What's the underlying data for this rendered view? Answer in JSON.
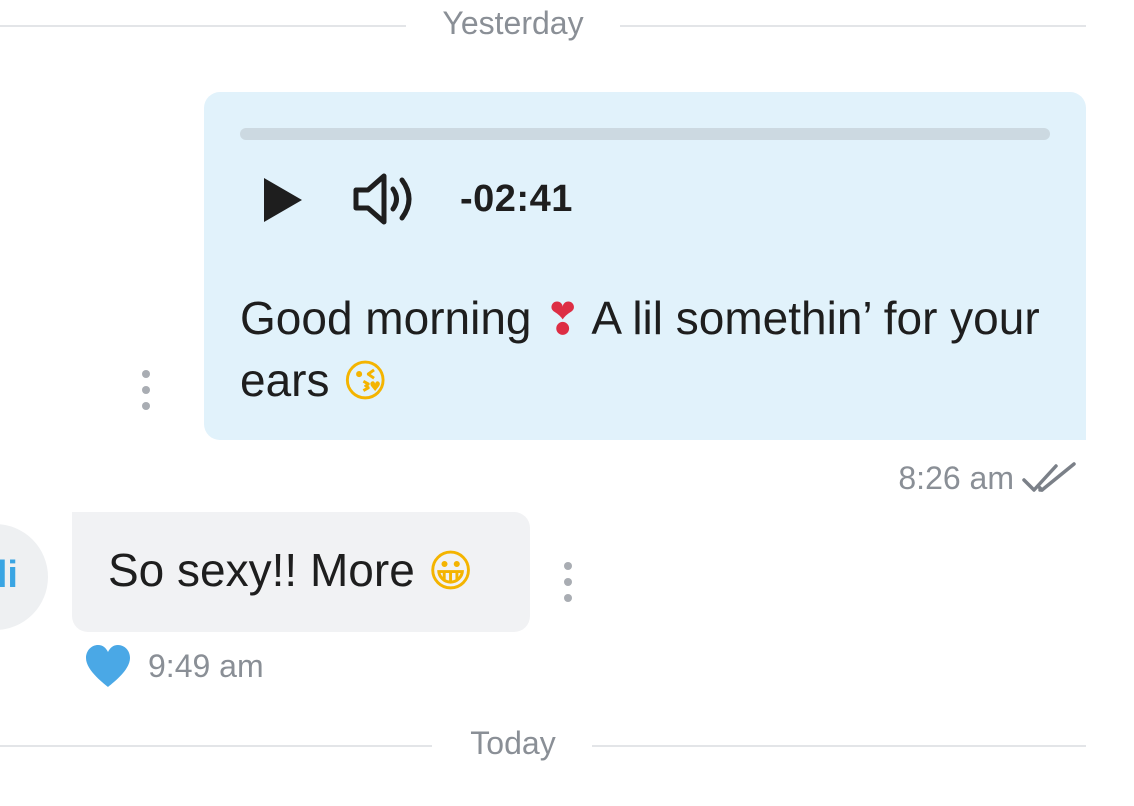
{
  "dividers": {
    "yesterday": "Yesterday",
    "today": "Today"
  },
  "outgoing": {
    "audio": {
      "time_remaining": "-02:41",
      "progress_fraction": 0,
      "play_icon": "play-icon",
      "volume_icon": "volume-icon"
    },
    "text": "Good morning",
    "emoji_heart": "❣",
    "text_after_emoji": "A lil somethin’ for your ears",
    "emoji_kiss": "😘",
    "time": "8:26 am",
    "status_icon": "double-check-icon"
  },
  "incoming": {
    "avatar_initials": "li",
    "text": "So sexy!! More",
    "emoji": "😀",
    "time": "9:49 am",
    "reaction_icon": "heart-icon"
  },
  "colors": {
    "outgoing_bubble": "#e1f2fb",
    "incoming_bubble": "#f1f2f4",
    "accent": "#3aa5e3",
    "meta_text": "#8a8f96"
  }
}
